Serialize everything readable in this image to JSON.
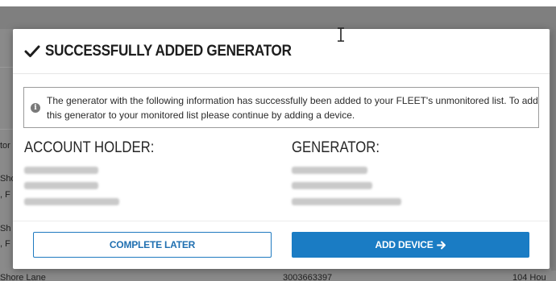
{
  "background": {
    "row_texts": [
      "tor",
      "Sho",
      ", F",
      "Sh",
      ", F",
      "Shore Lane",
      "3003663397",
      "104 Hou"
    ]
  },
  "modal": {
    "title": "SUCCESSFULLY ADDED GENERATOR",
    "notice": "The generator with the following information has successfully been added to your FLEET's unmonitored list. To add this generator to your monitored list please continue by adding a device.",
    "account_holder": {
      "heading": "ACCOUNT HOLDER:"
    },
    "generator": {
      "heading": "GENERATOR:"
    },
    "buttons": {
      "complete_later": "COMPLETE LATER",
      "add_device": "ADD DEVICE"
    }
  },
  "colors": {
    "accent": "#1a7cc4",
    "overlay": "#8a8a8a"
  },
  "icons": [
    "check-icon",
    "info-icon",
    "arrow-right-icon",
    "text-cursor-icon"
  ]
}
